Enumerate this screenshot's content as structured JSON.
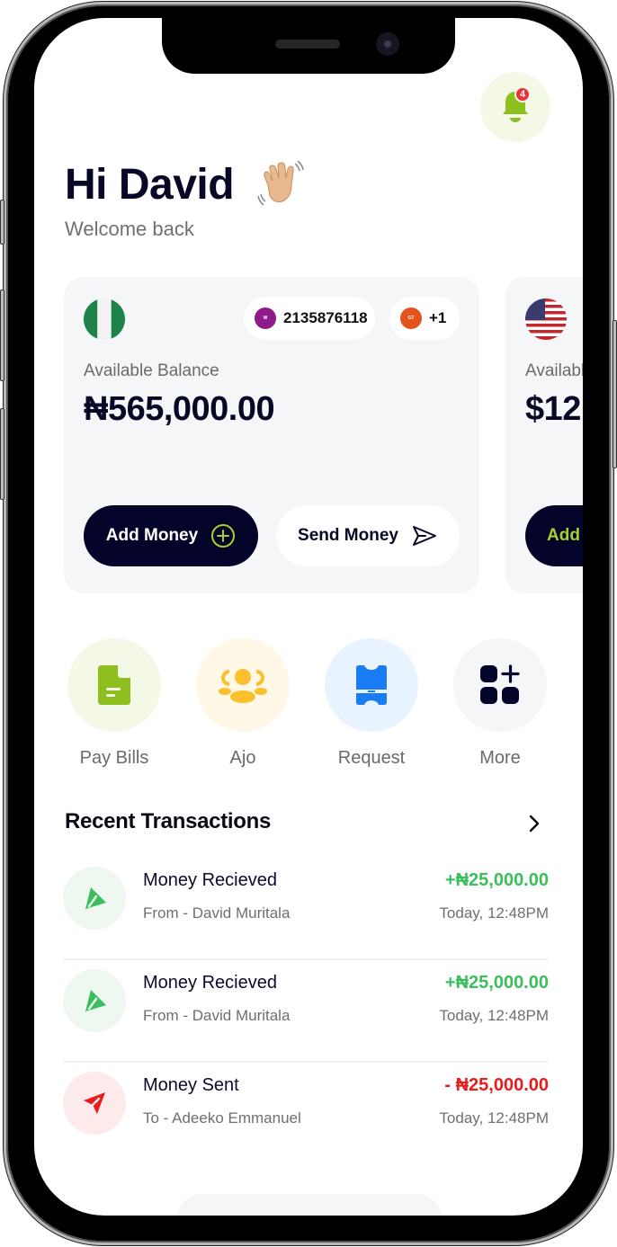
{
  "header": {
    "notification_count": "4",
    "greeting": "Hi David",
    "subtitle": "Welcome back"
  },
  "wallets": [
    {
      "currency": "NGN",
      "flag": "nigeria-flag",
      "account_chip": {
        "bank": "Wema Bank",
        "account_number": "2135876118"
      },
      "extra_chip": {
        "bank": "GTBank",
        "label": "+1"
      },
      "balance_label": "Available Balance",
      "balance": "₦565,000.00",
      "add_label": "Add Money",
      "send_label": "Send Money"
    },
    {
      "currency": "USD",
      "flag": "us-flag",
      "balance_label": "Available Balance",
      "balance": "$12",
      "add_label": "Add"
    }
  ],
  "quick_actions": [
    {
      "label": "Pay Bills",
      "icon": "bill-icon",
      "color": "#8dc01e",
      "bg": "#f3f9e6"
    },
    {
      "label": "Ajo",
      "icon": "group-icon",
      "color": "#fbc02d",
      "bg": "#fff8e6"
    },
    {
      "label": "Request",
      "icon": "ticket-icon",
      "color": "#1a7cf2",
      "bg": "#e9f3ff"
    },
    {
      "label": "More",
      "icon": "grid-plus-icon",
      "color": "#04042a",
      "bg": "#f5f6f8"
    }
  ],
  "recent": {
    "title": "Recent Transactions",
    "items": [
      {
        "title": "Money Recieved",
        "party": "From - David Muritala",
        "amount": "+₦25,000.00",
        "time": "Today, 12:48PM",
        "type": "credit",
        "color": "#3bbf5c"
      },
      {
        "title": "Money Recieved",
        "party": "From - David Muritala",
        "amount": "+₦25,000.00",
        "time": "Today, 12:48PM",
        "type": "credit",
        "color": "#3bbf5c"
      },
      {
        "title": "Money Sent",
        "party": "To - Adeeko Emmanuel",
        "amount": "- ₦25,000.00",
        "time": "Today, 12:48PM",
        "type": "debit",
        "color": "#e81c1c"
      }
    ]
  },
  "colors": {
    "primary_dark": "#04042a",
    "accent_green": "#a6d12a",
    "credit": "#3bbf5c",
    "debit": "#e81c1c"
  }
}
